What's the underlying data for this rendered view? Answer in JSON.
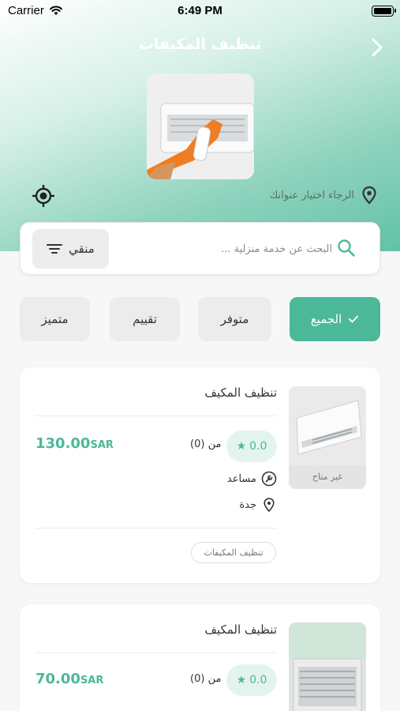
{
  "status_bar": {
    "carrier": "Carrier",
    "time": "6:49 PM"
  },
  "header": {
    "title": "تنظيف المكيفات"
  },
  "address": {
    "prompt": "الرجاء اختيار عنوانك"
  },
  "search": {
    "placeholder": "البحث عن خدمة منزلية ...",
    "filter_label": "منقي"
  },
  "filters": [
    {
      "label": "الجميع",
      "active": true
    },
    {
      "label": "متوفر",
      "active": false
    },
    {
      "label": "تقييم",
      "active": false
    },
    {
      "label": "متميز",
      "active": false
    }
  ],
  "services": [
    {
      "title": "تنظيف المكيف",
      "rating": "0.0",
      "reviews": "من (0)",
      "price": "130.00",
      "currency": "SAR",
      "role": "مساعد",
      "city": "جدة",
      "tag": "تنظيف المكيفات",
      "availability": "غير متاح"
    },
    {
      "title": "تنظيف المكيف",
      "rating": "0.0",
      "reviews": "من (0)",
      "price": "70.00",
      "currency": "SAR"
    }
  ],
  "colors": {
    "accent": "#4bb89a",
    "accent_light": "#e3f4ee"
  }
}
